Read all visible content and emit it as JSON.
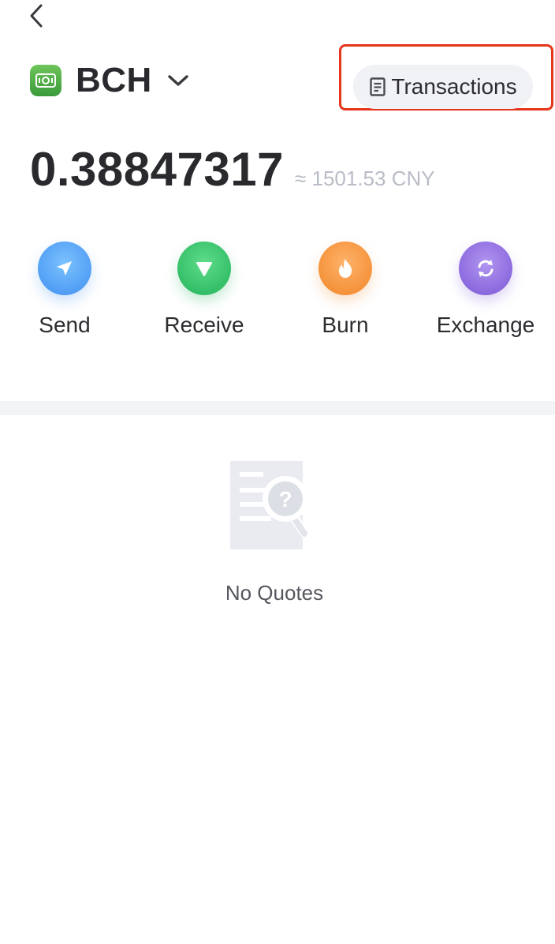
{
  "header": {
    "back_icon": "chevron-left-icon"
  },
  "coin": {
    "symbol": "BCH",
    "logo_icon": "bch-logo-icon",
    "dropdown_icon": "chevron-down-icon",
    "brand_color": "#4caf50"
  },
  "transactions": {
    "label": "Transactions",
    "icon": "document-icon",
    "highlight_color": "#e5361c"
  },
  "balance": {
    "amount": "0.38847317",
    "fiat": "≈ 1501.53 CNY"
  },
  "actions": [
    {
      "label": "Send",
      "icon": "send-arrow-icon",
      "color": "#3f8ff0"
    },
    {
      "label": "Receive",
      "icon": "receive-arrow-icon",
      "color": "#22b25a"
    },
    {
      "label": "Burn",
      "icon": "flame-icon",
      "color": "#f08628"
    },
    {
      "label": "Exchange",
      "icon": "exchange-icon",
      "color": "#7b58d6"
    }
  ],
  "empty_state": {
    "icon": "document-search-icon",
    "text": "No Quotes"
  }
}
